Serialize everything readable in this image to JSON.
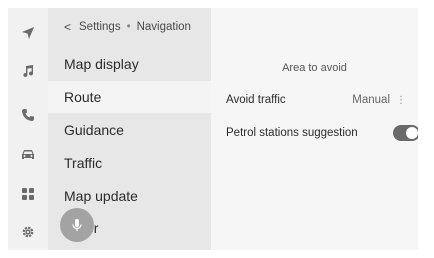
{
  "rail": {
    "items": [
      {
        "icon": "navigation-arrow-icon"
      },
      {
        "icon": "music-note-icon"
      },
      {
        "icon": "phone-icon"
      },
      {
        "icon": "car-icon"
      },
      {
        "icon": "apps-grid-icon"
      },
      {
        "icon": "settings-gear-icon"
      }
    ]
  },
  "breadcrumb": {
    "back": "<",
    "parent": "Settings",
    "separator": "•",
    "current": "Navigation"
  },
  "menu": {
    "items": [
      {
        "label": "Map display"
      },
      {
        "label": "Route",
        "selected": true
      },
      {
        "label": "Guidance"
      },
      {
        "label": "Traffic"
      },
      {
        "label": "Map update"
      },
      {
        "label": "er"
      }
    ]
  },
  "mic": {
    "icon": "microphone-icon"
  },
  "panel": {
    "section_title": "Area to avoid",
    "rows": [
      {
        "label": "Avoid traffic",
        "value": "Manual",
        "more": "⋮"
      },
      {
        "label": "Petrol stations suggestion",
        "toggle_on": true
      }
    ]
  },
  "colors": {
    "background": "#f1f1f1",
    "menu_bg": "#e7e7e7",
    "selected_bg": "#f4f4f4",
    "toggle_on": "#6a6a6a",
    "mic_bg": "#a3a3a3"
  }
}
